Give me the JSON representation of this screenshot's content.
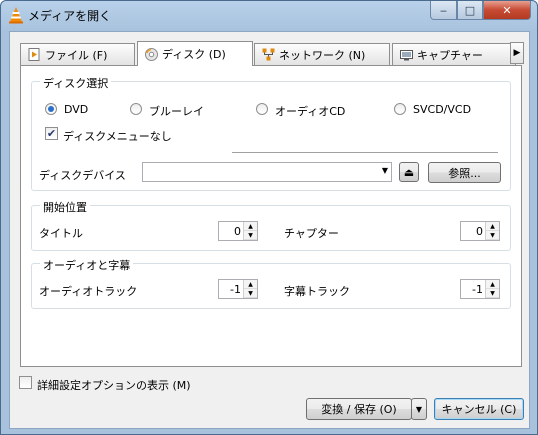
{
  "window": {
    "title": "メディアを開く",
    "minimize_glyph": "‒",
    "maximize_glyph": "□",
    "close_glyph": "✕"
  },
  "tabs": [
    {
      "label": "ファイル (F)",
      "icon": "file-icon"
    },
    {
      "label": "ディスク (D)",
      "icon": "disc-icon",
      "active": true
    },
    {
      "label": "ネットワーク (N)",
      "icon": "network-icon"
    },
    {
      "label": "キャプチャー",
      "icon": "capture-icon"
    }
  ],
  "tab_scroll_glyph": "▶",
  "disc_selection": {
    "title": "ディスク選択",
    "options": [
      {
        "label": "DVD",
        "selected": true
      },
      {
        "label": "ブルーレイ",
        "selected": false
      },
      {
        "label": "オーディオCD",
        "selected": false
      },
      {
        "label": "SVCD/VCD",
        "selected": false
      }
    ],
    "no_menu_label": "ディスクメニューなし",
    "no_menu_checked": true,
    "check_glyph": "✔",
    "device_label": "ディスクデバイス",
    "device_value": "",
    "dropdown_glyph": "▼",
    "eject_glyph": "⏏",
    "browse_label": "参照..."
  },
  "start_position": {
    "title": "開始位置",
    "title_label": "タイトル",
    "title_value": "0",
    "chapter_label": "チャプター",
    "chapter_value": "0"
  },
  "audio_subtitles": {
    "title": "オーディオと字幕",
    "audio_track_label": "オーディオトラック",
    "audio_track_value": "-1",
    "subtitle_track_label": "字幕トラック",
    "subtitle_track_value": "-1"
  },
  "spin_up_glyph": "▲",
  "spin_down_glyph": "▼",
  "footer": {
    "advanced_label": "詳細設定オプションの表示 (M)",
    "advanced_checked": false,
    "convert_label": "変換 / 保存 (O)",
    "convert_dropdown_glyph": "▼",
    "cancel_label": "キャンセル (C)"
  },
  "colors": {
    "accent": "#2a6fc9",
    "close_button": "#c74a33",
    "vlc_orange": "#f28b00"
  }
}
